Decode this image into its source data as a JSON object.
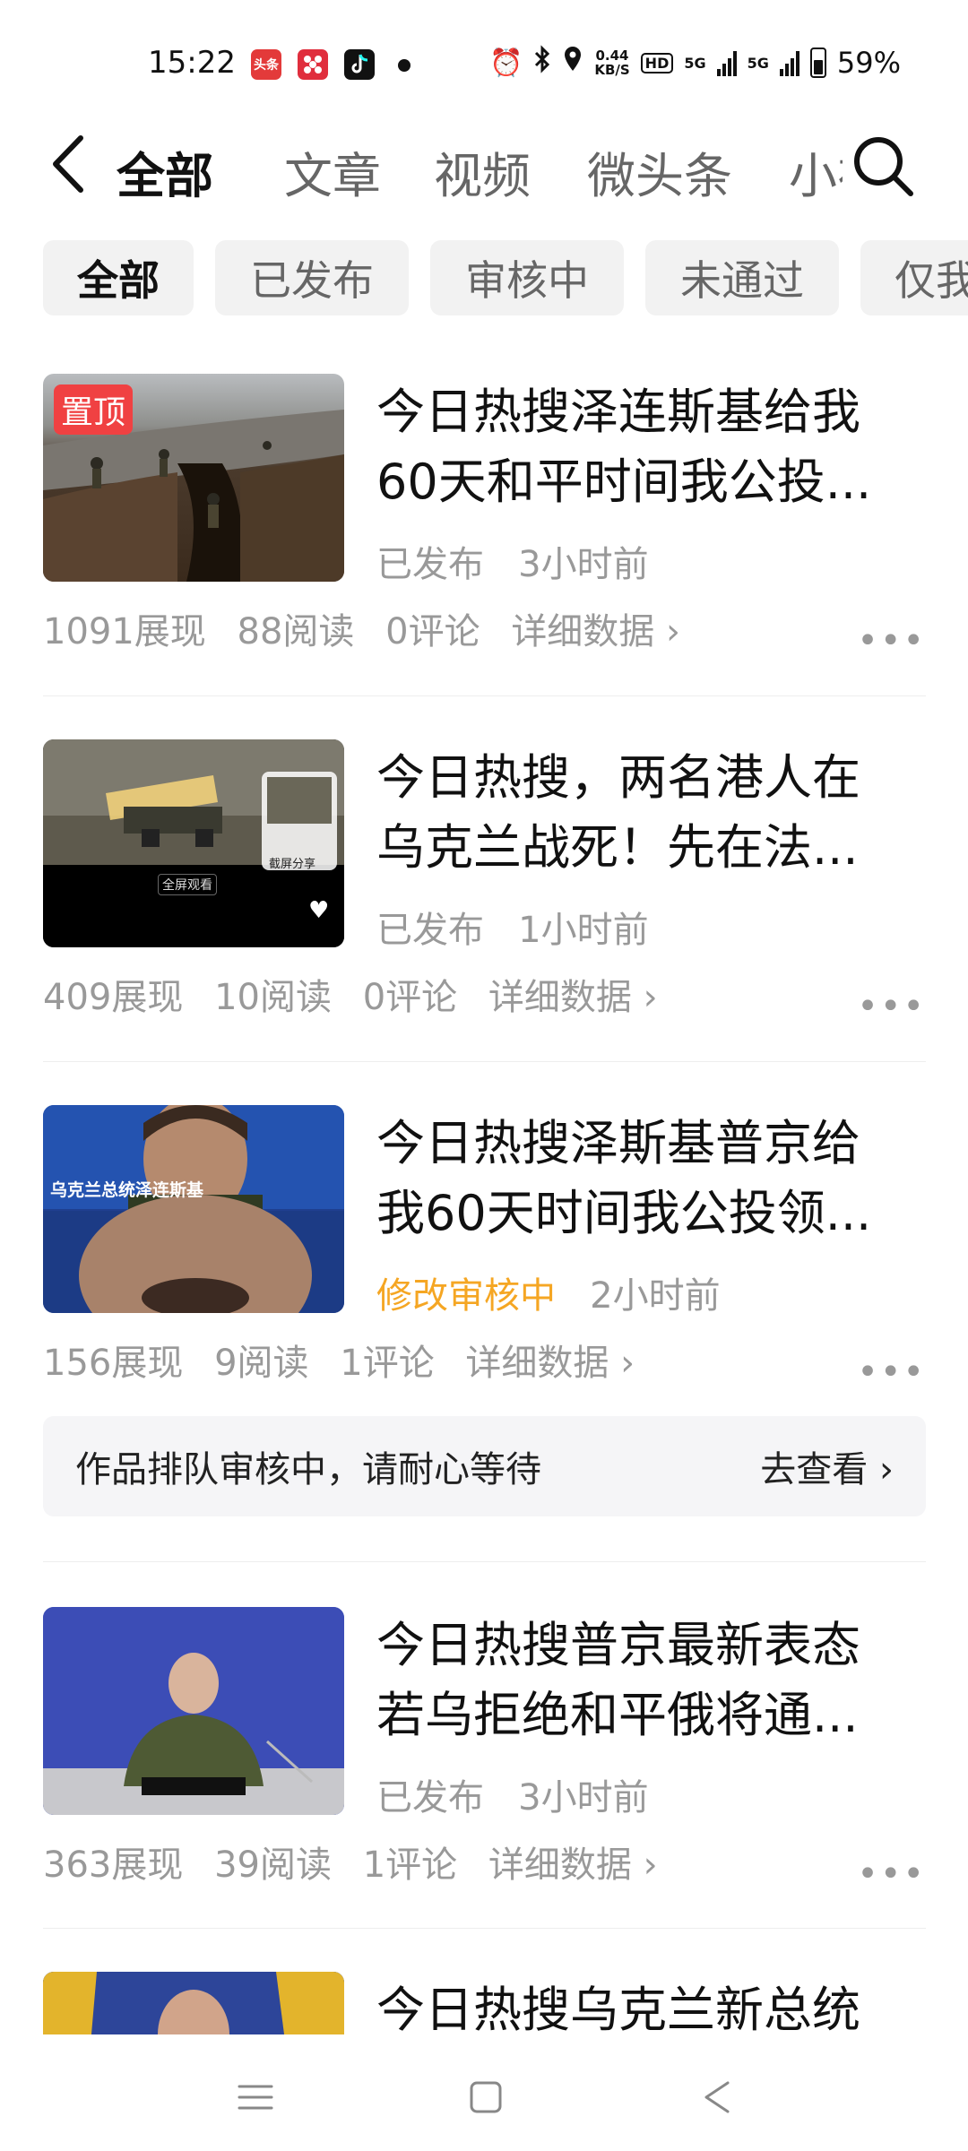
{
  "status_bar": {
    "time": "15:22",
    "app_icons": [
      "头条",
      "小红书",
      "抖音"
    ],
    "net_speed_value": "0.44",
    "net_speed_unit": "KB/S",
    "hd_badge": "HD",
    "network_1": "5G",
    "network_2": "5G",
    "battery": "59%"
  },
  "nav": {
    "tabs": [
      {
        "label": "全部",
        "active": true
      },
      {
        "label": "文章",
        "active": false
      },
      {
        "label": "视频",
        "active": false
      },
      {
        "label": "微头条",
        "active": false
      },
      {
        "label": "小视",
        "active": false
      }
    ]
  },
  "filters": [
    "全部",
    "已发布",
    "审核中",
    "未通过",
    "仅我"
  ],
  "articles": [
    {
      "pin_label": "置顶",
      "title_line1": "今日热搜泽连斯基给我",
      "title_line2": "60天和平时间我公投...",
      "status": "已发布",
      "time": "3小时前",
      "impressions": "1091展现",
      "reads": "88阅读",
      "comments": "0评论",
      "details": "详细数据 ›"
    },
    {
      "title_line1": "今日热搜，两名港人在",
      "title_line2": "乌克兰战死！先在法...",
      "status": "已发布",
      "time": "1小时前",
      "impressions": "409展现",
      "reads": "10阅读",
      "comments": "0评论",
      "details": "详细数据 ›",
      "thumb_overlay_1": "全屏观看",
      "thumb_overlay_2": "截屏分享"
    },
    {
      "title_line1": "今日热搜泽斯基普京给",
      "title_line2": "我60天时间我公投领...",
      "status": "修改审核中",
      "time": "2小时前",
      "impressions": "156展现",
      "reads": "9阅读",
      "comments": "1评论",
      "details": "详细数据 ›",
      "thumb_caption": "乌克兰总统泽连斯基"
    },
    {
      "title_line1": "今日热搜普京最新表态",
      "title_line2": "若乌拒绝和平俄将通...",
      "status": "已发布",
      "time": "3小时前",
      "impressions": "363展现",
      "reads": "39阅读",
      "comments": "1评论",
      "details": "详细数据 ›"
    },
    {
      "title_line1": "今日热搜乌克兰新总统"
    }
  ],
  "notice": {
    "text": "作品排队审核中，请耐心等待",
    "action": "去查看 ›"
  },
  "more_label": "•••",
  "colors": {
    "pin_badge": "#f04142",
    "review_status": "#f5a623",
    "chip_bg": "#f2f2f2",
    "muted_text": "#999999"
  }
}
